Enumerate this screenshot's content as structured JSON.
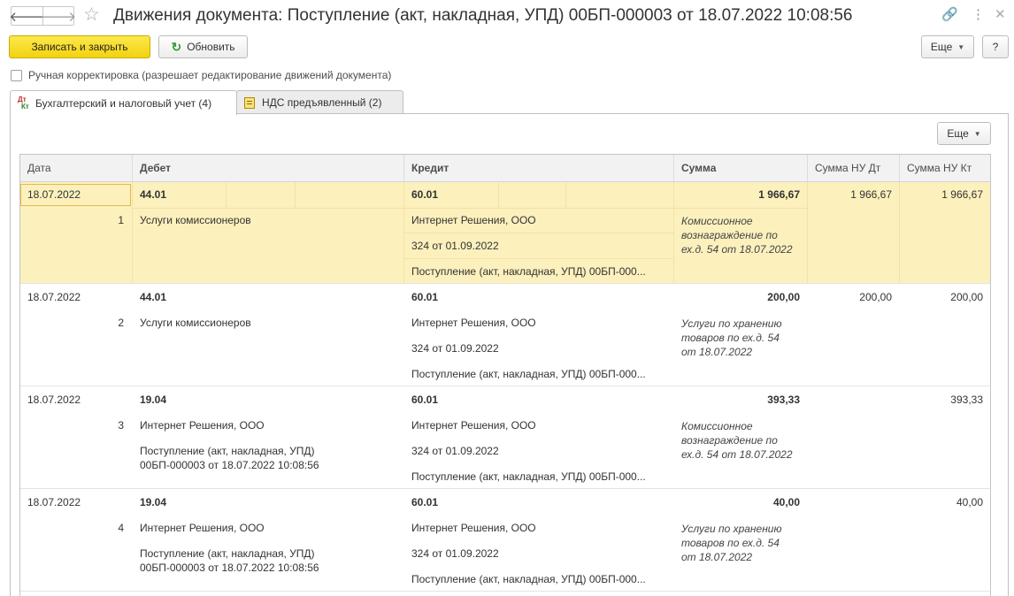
{
  "window": {
    "title": "Движения документа: Поступление (акт, накладная, УПД) 00БП-000003 от 18.07.2022 10:08:56",
    "back_glyph": "🡐",
    "forward_glyph": "🡒",
    "star_glyph": "☆",
    "link_glyph": "🔗",
    "menu_glyph": "⋮",
    "close_glyph": "✕"
  },
  "toolbar": {
    "save_close": "Записать и закрыть",
    "refresh": "Обновить",
    "refresh_glyph": "↻",
    "more": "Еще",
    "help": "?"
  },
  "manual_correction": {
    "label": "Ручная корректировка (разрешает редактирование движений документа)",
    "checked": false
  },
  "tabs": [
    {
      "label": "Бухгалтерский и налоговый учет (4)",
      "icon_top": "Дт",
      "icon_bottom": "Кт",
      "active": true
    },
    {
      "label": "НДС предъявленный (2)",
      "active": false
    }
  ],
  "grid_more": "Еще",
  "columns": [
    "Дата",
    "Дебет",
    "Кредит",
    "Сумма",
    "Сумма НУ Дт",
    "Сумма НУ Кт"
  ],
  "rows": [
    {
      "date": "18.07.2022",
      "num": "1",
      "debit_account": "44.01",
      "debit_lines": [
        "Услуги комиссионеров"
      ],
      "credit_account": "60.01",
      "credit_lines": [
        "Интернет Решения, ООО",
        "324 от 01.09.2022",
        "Поступление (акт, накладная, УПД) 00БП-000..."
      ],
      "sum": "1 966,67",
      "content": "Комиссионное вознаграждение по ех.д. 54 от 18.07.2022",
      "nu_dt": "1 966,67",
      "nu_kt": "1 966,67"
    },
    {
      "date": "18.07.2022",
      "num": "2",
      "debit_account": "44.01",
      "debit_lines": [
        "Услуги комиссионеров"
      ],
      "credit_account": "60.01",
      "credit_lines": [
        "Интернет Решения, ООО",
        "324 от 01.09.2022",
        "Поступление (акт, накладная, УПД) 00БП-000..."
      ],
      "sum": "200,00",
      "content": "Услуги по хранению товаров по ех.д. 54 от 18.07.2022",
      "nu_dt": "200,00",
      "nu_kt": "200,00"
    },
    {
      "date": "18.07.2022",
      "num": "3",
      "debit_account": "19.04",
      "debit_lines": [
        "Интернет Решения, ООО",
        "Поступление (акт, накладная, УПД) 00БП-000003 от 18.07.2022 10:08:56"
      ],
      "credit_account": "60.01",
      "credit_lines": [
        "Интернет Решения, ООО",
        "324 от 01.09.2022",
        "Поступление (акт, накладная, УПД) 00БП-000..."
      ],
      "sum": "393,33",
      "content": "Комиссионное вознаграждение по ех.д. 54 от 18.07.2022",
      "nu_dt": "",
      "nu_kt": "393,33"
    },
    {
      "date": "18.07.2022",
      "num": "4",
      "debit_account": "19.04",
      "debit_lines": [
        "Интернет Решения, ООО",
        "Поступление (акт, накладная, УПД) 00БП-000003 от 18.07.2022 10:08:56"
      ],
      "credit_account": "60.01",
      "credit_lines": [
        "Интернет Решения, ООО",
        "324 от 01.09.2022",
        "Поступление (акт, накладная, УПД) 00БП-000..."
      ],
      "sum": "40,00",
      "content": "Услуги по хранению товаров по ех.д. 54 от 18.07.2022",
      "nu_dt": "",
      "nu_kt": "40,00"
    }
  ],
  "colors": {
    "primary_button": "#f3d310",
    "selected_row": "#fcf0bd",
    "refresh_icon": "#3a9a3a"
  }
}
